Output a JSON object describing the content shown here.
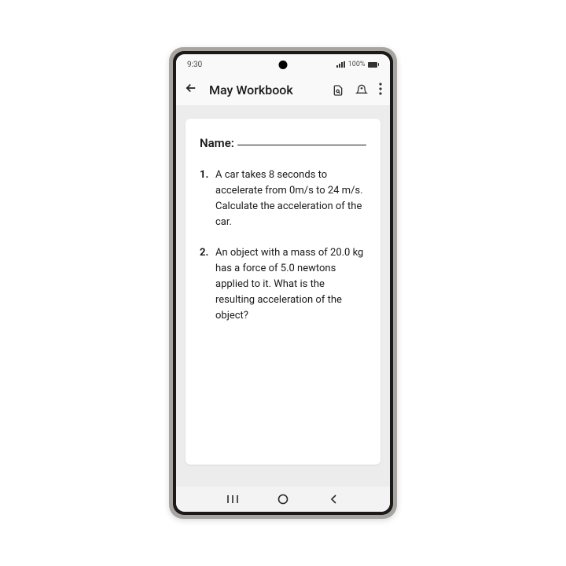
{
  "status": {
    "time": "9:30",
    "battery_pct": "100%"
  },
  "header": {
    "title": "May Workbook"
  },
  "document": {
    "name_label": "Name:",
    "questions": [
      {
        "num": "1.",
        "text": "A car takes 8 seconds to accelerate from 0m/s to 24 m/s. Calculate the acceleration of the car."
      },
      {
        "num": "2.",
        "text": "An object with a mass of 20.0 kg has a force of 5.0 newtons applied to it. What is the resulting acceleration of the object?"
      }
    ]
  }
}
